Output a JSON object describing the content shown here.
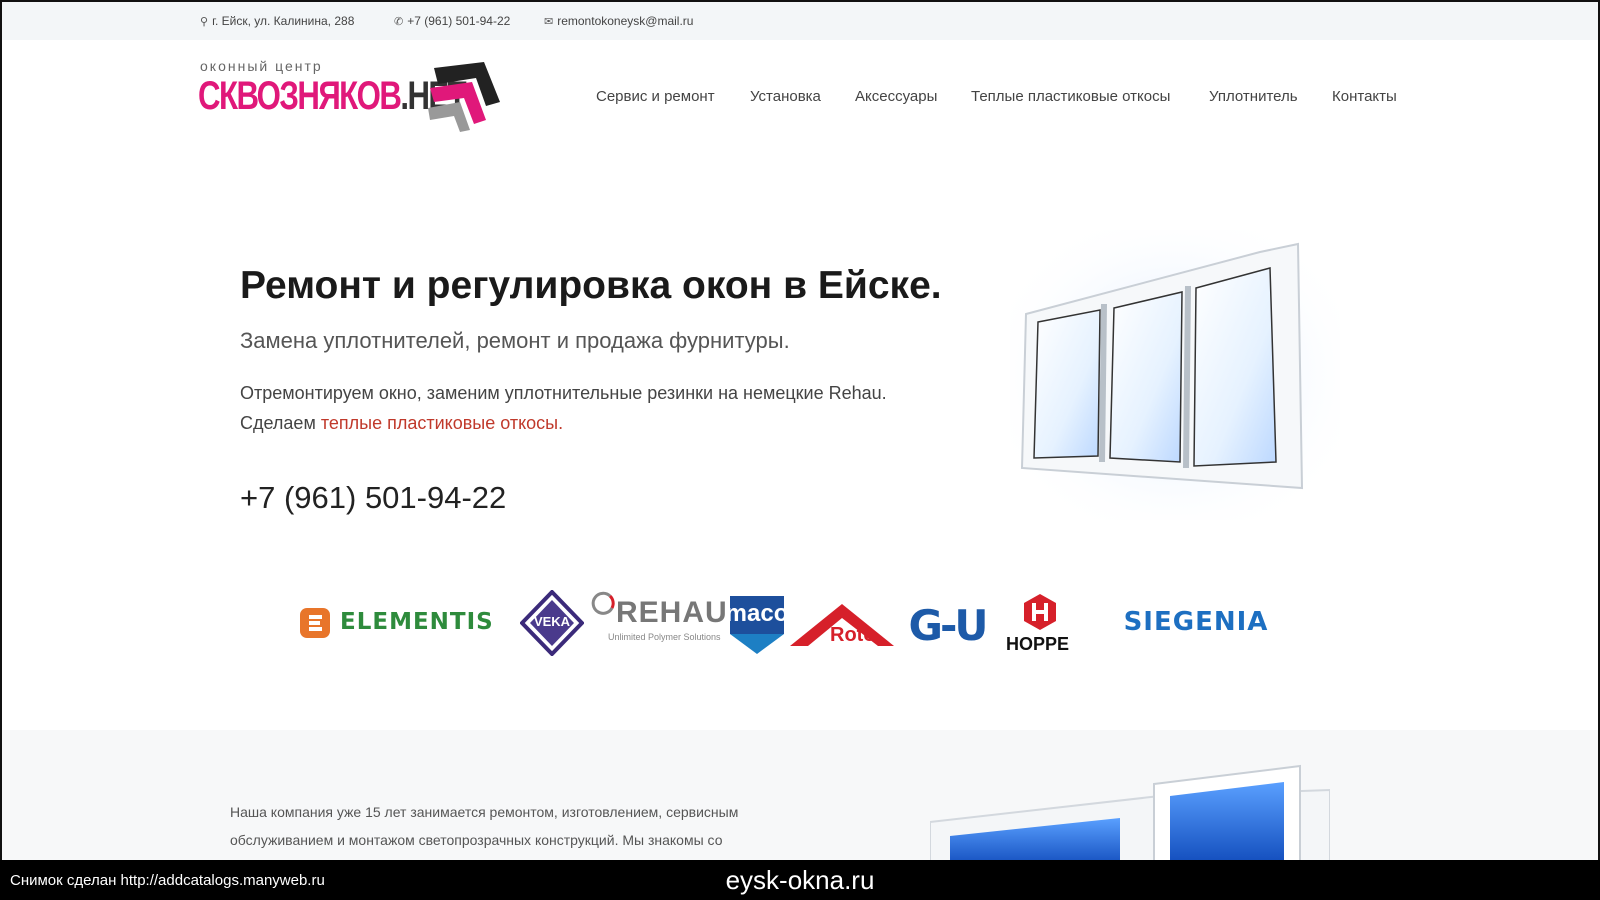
{
  "topbar": {
    "address": "г. Ейск, ул. Калинина, 288",
    "phone": "+7 (961) 501-94-22",
    "email": "remontokoneysk@mail.ru"
  },
  "logo": {
    "tagline": "оконный центр",
    "brand_main": "СКВОЗНЯКОВ",
    "brand_suffix": ".НЕТ"
  },
  "nav": [
    "Сервис и ремонт",
    "Установка",
    "Аксессуары",
    "Теплые пластиковые откосы",
    "Уплотнитель",
    "Контакты"
  ],
  "hero": {
    "title": "Ремонт и регулировка окон в Ейске.",
    "subtitle": "Замена уплотнителей, ремонт и продажа фурнитуры.",
    "text_line1": "Отремонтируем окно, заменим уплотнительные резинки на немецкие Rehau.",
    "text_line2_prefix": "Сделаем ",
    "text_link": "теплые пластиковые откосы.",
    "phone": "+7 (961) 501-94-22"
  },
  "brands": {
    "elementis": "ELEMENTIS",
    "veka": "VEKA",
    "rehau": "REHAU",
    "rehau_sub": "Unlimited Polymer Solutions",
    "maco": "maco",
    "roto": "Roto",
    "gu": "G-U",
    "hoppe": "HOPPE",
    "siegenia": "SIEGENIA"
  },
  "about": {
    "line1": "Наша компания уже 15 лет занимается ремонтом, изготовлением, сервисным",
    "line2": "обслуживанием и монтажом светопрозрачных конструкций. Мы знакомы со"
  },
  "strip": {
    "left": "Снимок сделан http://addcatalogs.manyweb.ru",
    "center": "eysk-okna.ru"
  },
  "colors": {
    "accent": "#e0187a",
    "link": "#c0392b",
    "topbar_bg": "#f3f6f8"
  }
}
